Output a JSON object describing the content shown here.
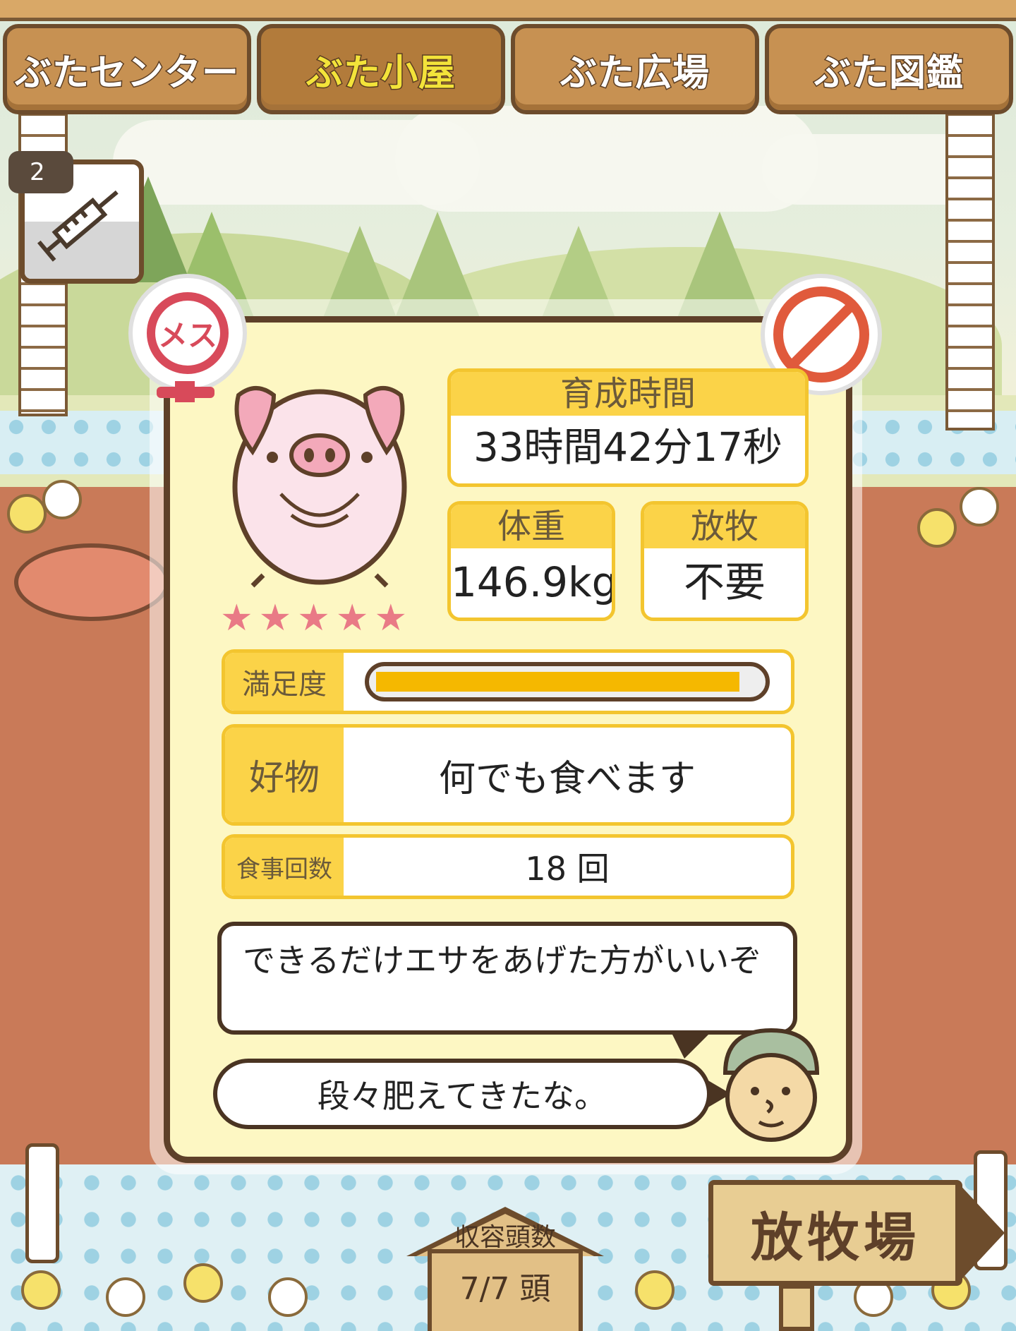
{
  "nav": {
    "tabs": [
      {
        "label": "ぶたセンター",
        "active": false
      },
      {
        "label": "ぶた小屋",
        "active": true
      },
      {
        "label": "ぶた広場",
        "active": false
      },
      {
        "label": "ぶた図鑑",
        "active": false
      }
    ]
  },
  "item": {
    "count": "2",
    "icon": "syringe-icon"
  },
  "pig": {
    "gender_label": "メス",
    "stars": [
      "★",
      "★",
      "★",
      "★",
      "★"
    ],
    "rating_of_5": 5,
    "vaccine_status_icon": "no-syringe-icon"
  },
  "stats": {
    "raising_time_label": "育成時間",
    "raising_time_value": "33時間42分17秒",
    "weight_label": "体重",
    "weight_value": "146.9kg",
    "grazing_label": "放牧",
    "grazing_value": "不要"
  },
  "satisfaction": {
    "label": "満足度",
    "level": 0.95
  },
  "favorite": {
    "label": "好物",
    "value": "何でも食べます"
  },
  "meals": {
    "label": "食事回数",
    "value": "18 回"
  },
  "messages": {
    "advice": "できるだけエサをあげた方がいいぞ",
    "comment": "段々肥えてきたな。"
  },
  "capacity": {
    "label": "収容頭数",
    "value": "7/7 頭"
  },
  "pasture_button": {
    "label": "放牧場"
  },
  "colors": {
    "accent": "#fbd348",
    "card_bg": "#fdf7c3",
    "frame": "#5e4029",
    "bar_fill": "#f5b800",
    "star": "#e97a86",
    "female": "#d84a5a"
  }
}
